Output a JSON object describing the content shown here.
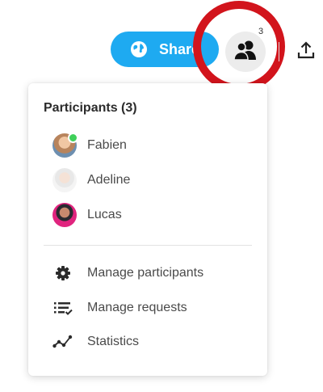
{
  "toolbar": {
    "share_label": "Share",
    "participant_count": "3",
    "share_color": "#1eaaf1",
    "highlight_color": "#d2141c",
    "icons": {
      "share": "globe-icon",
      "participants": "people-icon",
      "export": "upload-icon"
    }
  },
  "participants_panel": {
    "title": "Participants (3)",
    "participants": [
      {
        "name": "Fabien",
        "online": true
      },
      {
        "name": "Adeline",
        "online": false
      },
      {
        "name": "Lucas",
        "online": false
      }
    ],
    "actions": [
      {
        "label": "Manage participants",
        "icon": "gear-icon"
      },
      {
        "label": "Manage requests",
        "icon": "checklist-icon"
      },
      {
        "label": "Statistics",
        "icon": "stats-icon"
      }
    ],
    "online_color": "#3fd05a"
  }
}
